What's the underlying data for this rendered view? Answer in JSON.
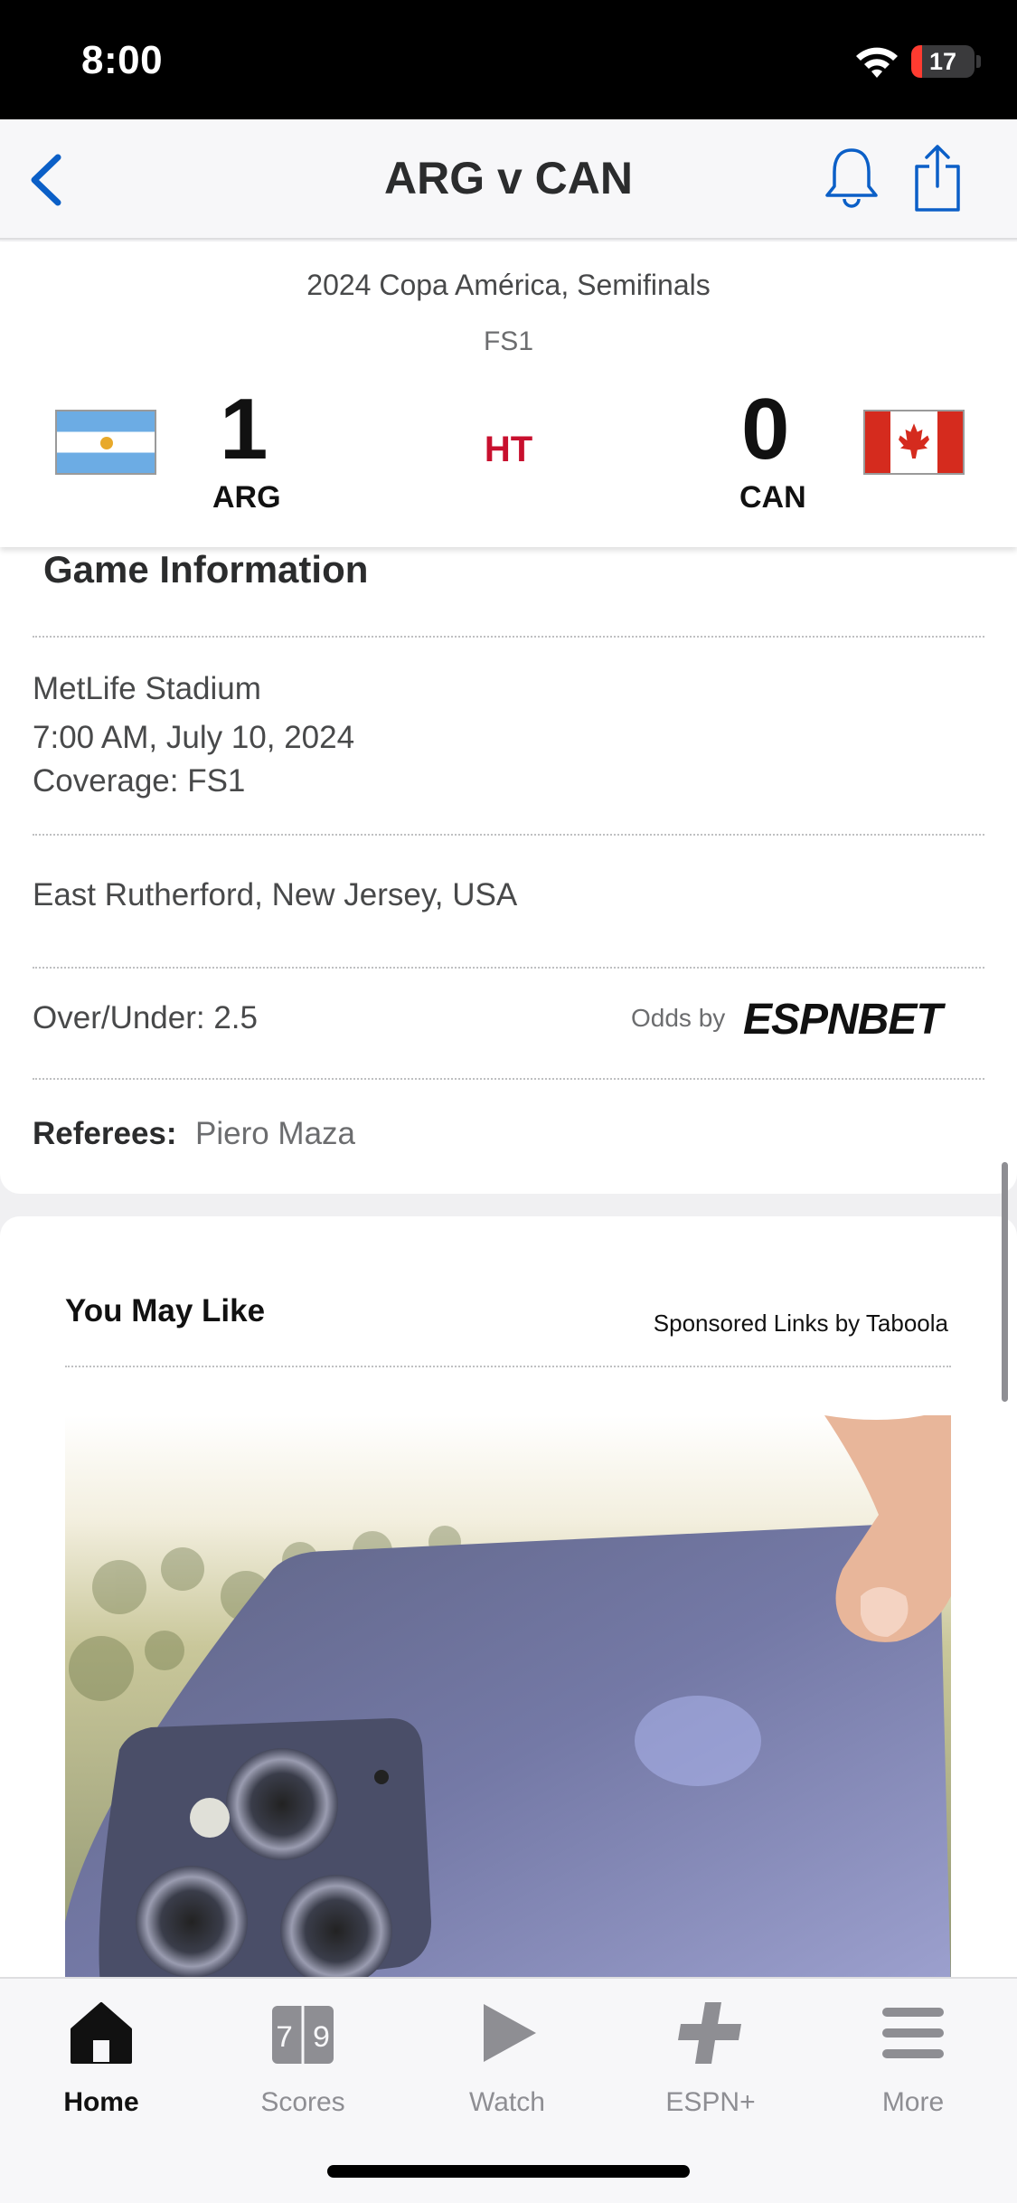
{
  "status_bar": {
    "time": "8:00",
    "battery": "17",
    "battery_level": 0.17
  },
  "nav": {
    "title": "ARG v CAN"
  },
  "scoreboard": {
    "event": "2024 Copa América, Semifinals",
    "network": "FS1",
    "status": "HT",
    "home": {
      "abbr": "ARG",
      "score": "1"
    },
    "away": {
      "abbr": "CAN",
      "score": "0"
    }
  },
  "game_info": {
    "title": "Game Information",
    "venue": "MetLife Stadium",
    "datetime": "7:00 AM, July 10, 2024",
    "coverage": "Coverage: FS1",
    "location": "East Rutherford, New Jersey, USA",
    "over_under": "Over/Under: 2.5",
    "odds_by": "Odds by",
    "odds_brand": "ESPNBET",
    "referees_label": "Referees:",
    "referees": "Piero Maza"
  },
  "you_may_like": {
    "title": "You May Like",
    "sponsored": "Sponsored Links by Taboola"
  },
  "scores_icon_digits": "7|9",
  "tabs": [
    {
      "label": "Home",
      "icon": "home-icon",
      "active": true
    },
    {
      "label": "Scores",
      "icon": "scores-icon",
      "active": false
    },
    {
      "label": "Watch",
      "icon": "play-icon",
      "active": false
    },
    {
      "label": "ESPN+",
      "icon": "plus-icon",
      "active": false
    },
    {
      "label": "More",
      "icon": "menu-icon",
      "active": false
    }
  ],
  "colors": {
    "accent": "#0b5fc7",
    "live_red": "#c8102e"
  }
}
